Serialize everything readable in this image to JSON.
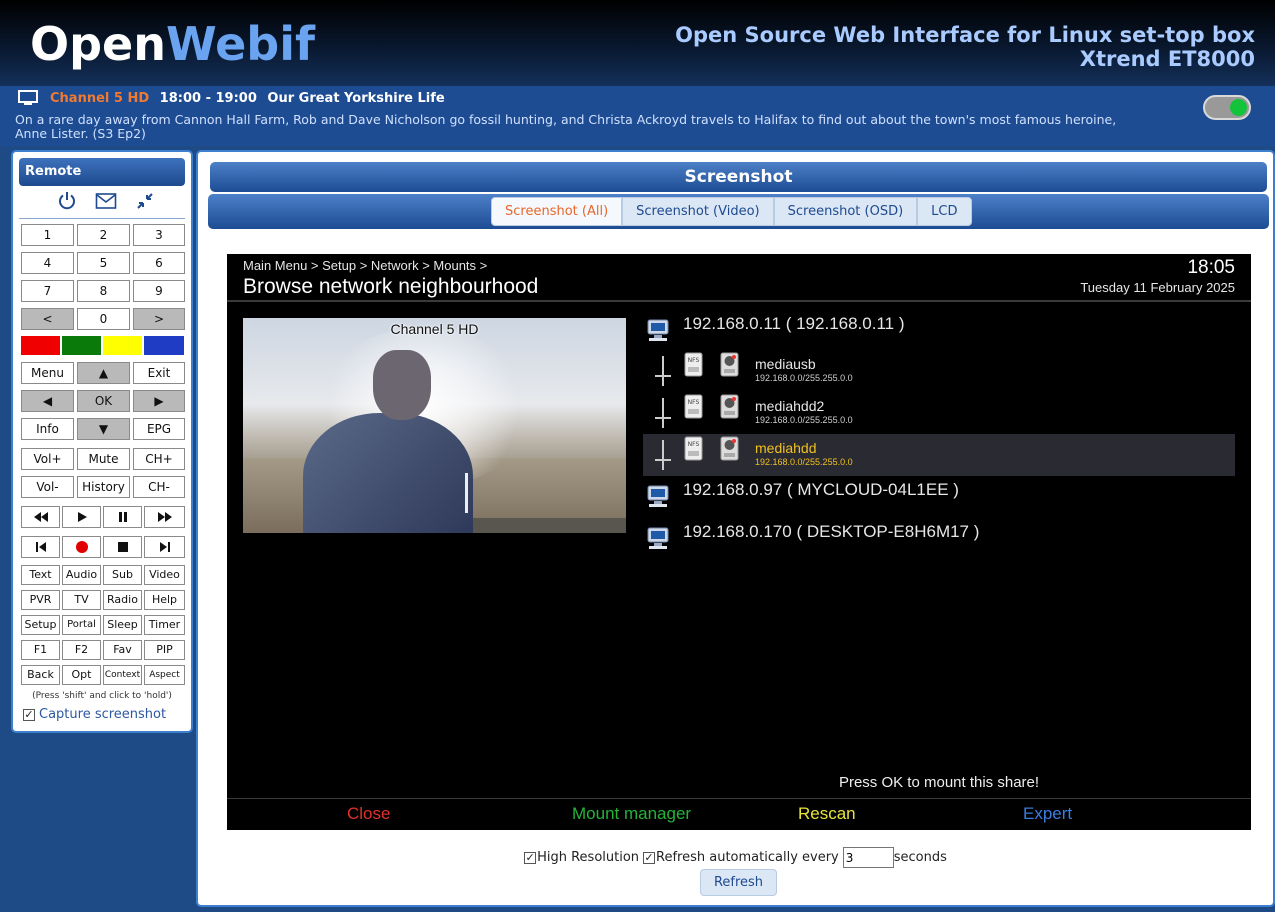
{
  "header": {
    "logo_open": "Open",
    "logo_webif": "Webif",
    "tagline": "Open Source Web Interface for Linux set-top box",
    "device": "Xtrend ET8000"
  },
  "now_playing": {
    "channel": "Channel 5 HD",
    "time": "18:00 - 19:00",
    "program": "Our Great Yorkshire Life",
    "description": "On a rare day away from Cannon Hall Farm, Rob and Dave Nicholson go fossil hunting, and Christa Ackroyd travels to Halifax to find out about the town's most famous heroine, Anne Lister. (S3 Ep2)",
    "toggle_on": true
  },
  "remote": {
    "title": "Remote",
    "icons": [
      "power-icon",
      "mail-icon",
      "minimize-icon"
    ],
    "digits": [
      "1",
      "2",
      "3",
      "4",
      "5",
      "6",
      "7",
      "8",
      "9"
    ],
    "prev": "<",
    "zero": "0",
    "next": ">",
    "colors": [
      "#f00000",
      "#0a7a0a",
      "#ffff00",
      "#1f3cc4"
    ],
    "menu": "Menu",
    "up": "▲",
    "exit": "Exit",
    "left": "◀",
    "ok": "OK",
    "right": "▶",
    "info": "Info",
    "down": "▼",
    "epg": "EPG",
    "volup": "Vol+",
    "mute": "Mute",
    "chup": "CH+",
    "voldown": "Vol-",
    "history": "History",
    "chdown": "CH-",
    "text": "Text",
    "audio": "Audio",
    "sub": "Sub",
    "video": "Video",
    "pvr": "PVR",
    "tv": "TV",
    "radio": "Radio",
    "help": "Help",
    "setup": "Setup",
    "portal": "Portal",
    "sleep": "Sleep",
    "timer": "Timer",
    "f1": "F1",
    "f2": "F2",
    "fav": "Fav",
    "pip": "PIP",
    "back": "Back",
    "opt": "Opt",
    "context": "Context",
    "aspect": "Aspect",
    "hold_note": "(Press 'shift' and click to 'hold')",
    "capture_label": "Capture screenshot",
    "capture_checked": true
  },
  "main": {
    "title": "Screenshot",
    "tabs": [
      "Screenshot (All)",
      "Screenshot (Video)",
      "Screenshot (OSD)",
      "LCD"
    ],
    "active_tab": "Screenshot (All)"
  },
  "tvscreen": {
    "breadcrumb": "Main Menu > Setup > Network > Mounts >",
    "heading": "Browse network neighbourhood",
    "clock": "18:05",
    "date": "Tuesday 11 February 2025",
    "preview_channel": "Channel 5 HD",
    "hosts": [
      {
        "label": "192.168.0.11 ( 192.168.0.11 )"
      },
      {
        "label": "192.168.0.97 ( MYCLOUD-04L1EE )"
      },
      {
        "label": "192.168.0.170 ( DESKTOP-E8H6M17 )"
      }
    ],
    "shares": [
      {
        "name": "mediausb",
        "ip": "192.168.0.0/255.255.0.0",
        "selected": false
      },
      {
        "name": "mediahdd2",
        "ip": "192.168.0.0/255.255.0.0",
        "selected": false
      },
      {
        "name": "mediahdd",
        "ip": "192.168.0.0/255.255.0.0",
        "selected": true
      }
    ],
    "hint": "Press OK to mount this share!",
    "keys": [
      {
        "label": "Close",
        "color": "#e0302a"
      },
      {
        "label": "Mount manager",
        "color": "#25b33a"
      },
      {
        "label": "Rescan",
        "color": "#e8e43a"
      },
      {
        "label": "Expert",
        "color": "#3b7de0"
      }
    ]
  },
  "controls": {
    "high_res_label": "High Resolution",
    "high_res_checked": true,
    "auto_label": "Refresh automatically every",
    "auto_checked": true,
    "interval": "3",
    "seconds": "seconds",
    "refresh": "Refresh"
  }
}
